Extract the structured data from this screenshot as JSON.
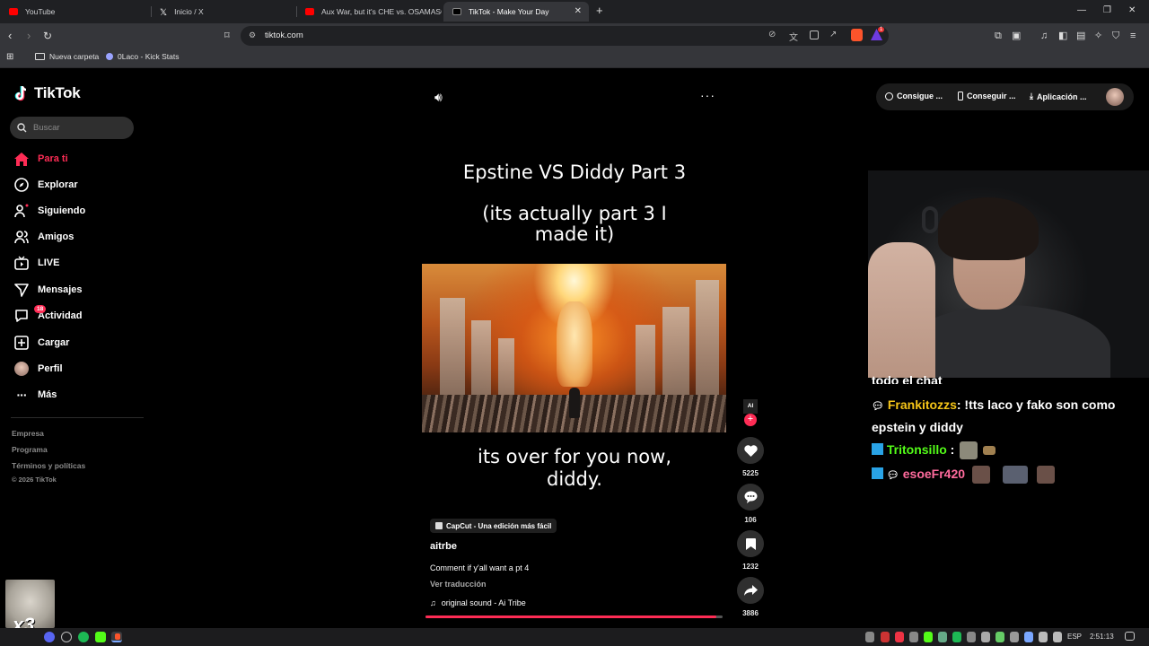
{
  "browser": {
    "tabs": [
      {
        "title": "YouTube",
        "color": "#ff0000"
      },
      {
        "title": "Inicio / X",
        "color": "#ffffff"
      },
      {
        "title": "Aux War, but it's CHE vs. OSAMASON",
        "color": "#ff0000"
      },
      {
        "title": "TikTok - Make Your Day",
        "color": "#ffffff",
        "active": true
      }
    ],
    "new_tab_icon": "plus-icon",
    "url": "tiktok.com",
    "bookmarks": [
      {
        "label": "Nueva carpeta",
        "icon": "folder-icon"
      },
      {
        "label": "0Laco - Kick Stats",
        "icon": "link-icon"
      }
    ],
    "notification_count": "1"
  },
  "tiktok": {
    "logo_text": "TikTok",
    "search_placeholder": "Buscar",
    "nav": [
      {
        "label": "Para ti",
        "icon": "home-icon",
        "active": true
      },
      {
        "label": "Explorar",
        "icon": "compass-icon"
      },
      {
        "label": "Siguiendo",
        "icon": "user-plus-icon"
      },
      {
        "label": "Amigos",
        "icon": "friends-icon"
      },
      {
        "label": "LIVE",
        "icon": "live-icon"
      },
      {
        "label": "Mensajes",
        "icon": "send-icon"
      },
      {
        "label": "Actividad",
        "icon": "activity-icon",
        "badge": "18"
      },
      {
        "label": "Cargar",
        "icon": "upload-icon"
      },
      {
        "label": "Perfil",
        "icon": "avatar-icon"
      },
      {
        "label": "Más",
        "icon": "more-icon"
      }
    ],
    "footer_links": [
      "Empresa",
      "Programa",
      "Términos y políticas",
      "© 2026 TikTok"
    ],
    "top_right": [
      "Consigue ...",
      "Conseguir ...",
      "Aplicación ..."
    ],
    "accent": "#fe2c55"
  },
  "video": {
    "title_line": "Epstine VS Diddy Part 3",
    "subtitle": "(its actually part 3 I made it)",
    "bottom_text": "its over for you now, diddy.",
    "capcut_label": "CapCut - Una edición más fácil",
    "author": "aitrbe",
    "caption": "Comment if y'all want a pt 4",
    "translate": "Ver traducción",
    "sound": "original sound - Ai Tribe",
    "progress": 0.98,
    "likes": "5225",
    "comments": "106",
    "saves": "1232",
    "shares": "3886",
    "creator_avatar_text": "AI"
  },
  "chat": {
    "partial_line": "todo el chat",
    "messages": [
      {
        "user": "Frankitozzs",
        "user_color": "#f5c518",
        "text": ": !tts laco y fako son como epstein y diddy"
      },
      {
        "user": "Tritonsillo",
        "user_color": "#53fc18",
        "text": ":"
      },
      {
        "user": "esoeFr420",
        "user_color": "#ff6b9d",
        "text": ""
      }
    ]
  },
  "overlay": {
    "seal_text": "x3"
  },
  "taskbar": {
    "language": "ESP",
    "time": "2:51:13"
  }
}
